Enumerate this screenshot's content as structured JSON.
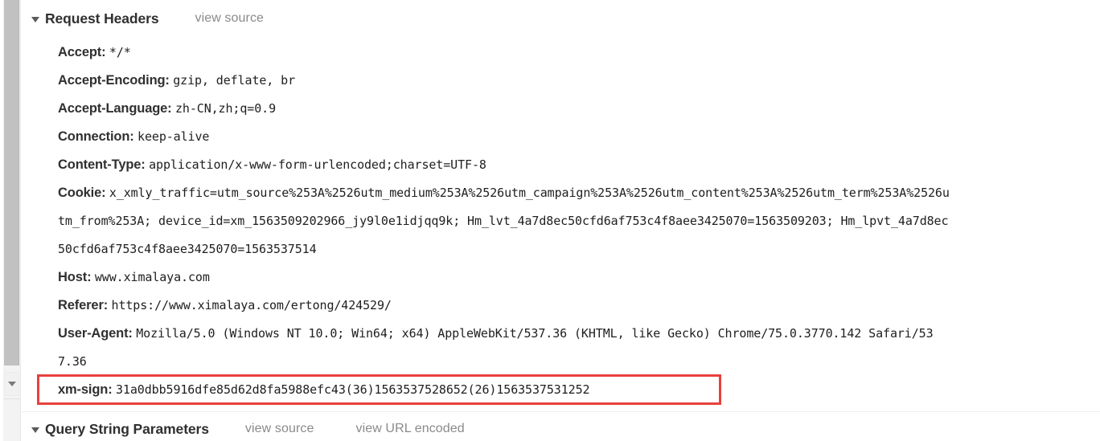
{
  "scrollbar": {
    "thumb_label": "vertical-scroll-thumb",
    "arrow_down_label": "scroll-down-arrow"
  },
  "sections": {
    "request_headers": {
      "title": "Request Headers",
      "view_source": "view source",
      "collapsed": false
    },
    "query_string_parameters": {
      "title": "Query String Parameters",
      "view_source": "view source",
      "view_url_encoded": "view URL encoded",
      "collapsed": false
    }
  },
  "headers": [
    {
      "name": "Accept:",
      "value": "*/*"
    },
    {
      "name": "Accept-Encoding:",
      "value": "gzip, deflate, br"
    },
    {
      "name": "Accept-Language:",
      "value": "zh-CN,zh;q=0.9"
    },
    {
      "name": "Connection:",
      "value": "keep-alive"
    },
    {
      "name": "Content-Type:",
      "value": "application/x-www-form-urlencoded;charset=UTF-8"
    },
    {
      "name": "Cookie:",
      "value": "x_xmly_traffic=utm_source%253A%2526utm_medium%253A%2526utm_campaign%253A%2526utm_content%253A%2526utm_term%253A%2526u"
    },
    {
      "name": "",
      "value": "tm_from%253A; device_id=xm_1563509202966_jy9l0e1idjqq9k; Hm_lvt_4a7d8ec50cfd6af753c4f8aee3425070=1563509203; Hm_lpvt_4a7d8ec"
    },
    {
      "name": "",
      "value": "50cfd6af753c4f8aee3425070=1563537514"
    },
    {
      "name": "Host:",
      "value": "www.ximalaya.com"
    },
    {
      "name": "Referer:",
      "value": "https://www.ximalaya.com/ertong/424529/"
    },
    {
      "name": "User-Agent:",
      "value": "Mozilla/5.0 (Windows NT 10.0; Win64; x64) AppleWebKit/537.36 (KHTML, like Gecko) Chrome/75.0.3770.142 Safari/53"
    },
    {
      "name": "",
      "value": "7.36"
    },
    {
      "name": "xm-sign:",
      "value": "31a0dbb5916dfe85d62d8fa5988efc43(36)1563537528652(26)1563537531252",
      "highlighted": true
    }
  ],
  "colors": {
    "highlight_border": "#e8413c",
    "header_name": "#303030",
    "header_value": "#202020",
    "link": "#8a8a8a",
    "scrollbar_thumb": "#c1c1c1",
    "scrollbar_track": "#f1f1f1"
  }
}
